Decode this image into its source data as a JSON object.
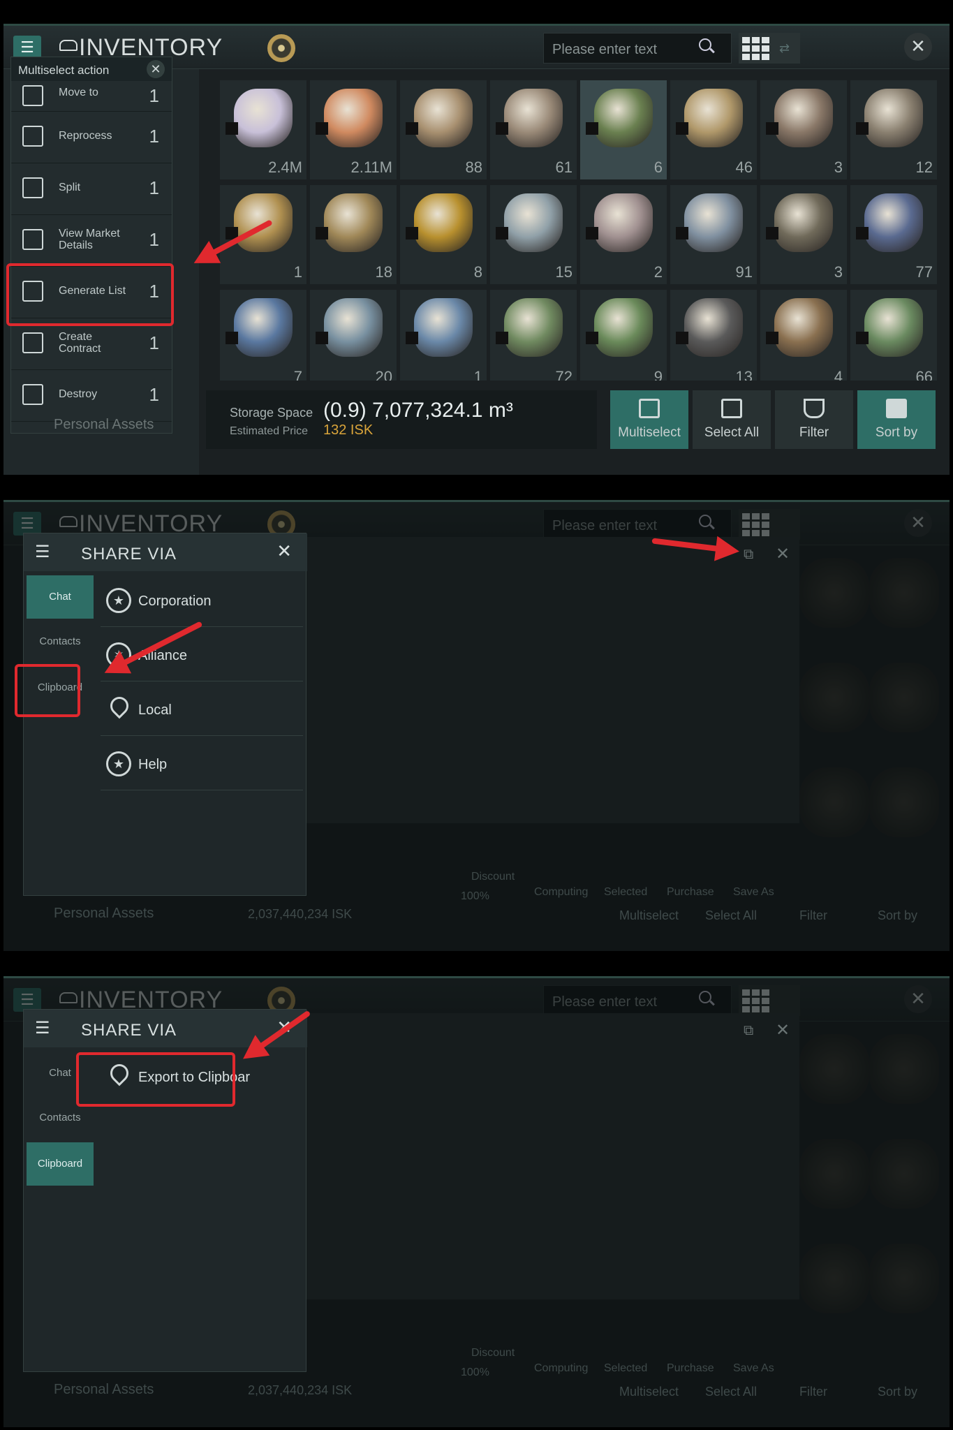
{
  "inventory": {
    "title": "INVENTORY",
    "search_placeholder": "Please enter text",
    "items": [
      {
        "count": "2.4M",
        "color": "#c8c0d8"
      },
      {
        "count": "2.11M",
        "color": "#d08a60"
      },
      {
        "count": "88",
        "color": "#a89070"
      },
      {
        "count": "61",
        "color": "#9a8a78"
      },
      {
        "count": "6",
        "color": "#6a8050",
        "selected": true
      },
      {
        "count": "46",
        "color": "#b0986a"
      },
      {
        "count": "3",
        "color": "#8a7868"
      },
      {
        "count": "12",
        "color": "#8a8070"
      },
      {
        "count": "1",
        "color": "#b09050"
      },
      {
        "count": "18",
        "color": "#a08858"
      },
      {
        "count": "8",
        "color": "#b8902e"
      },
      {
        "count": "15",
        "color": "#90a0a8"
      },
      {
        "count": "2",
        "color": "#a09090"
      },
      {
        "count": "91",
        "color": "#8090a0"
      },
      {
        "count": "3",
        "color": "#706a5a"
      },
      {
        "count": "77",
        "color": "#5a6a90"
      },
      {
        "count": "7",
        "color": "#5a78a0"
      },
      {
        "count": "20",
        "color": "#7890a0"
      },
      {
        "count": "1",
        "color": "#6a88a8"
      },
      {
        "count": "72",
        "color": "#708a60"
      },
      {
        "count": "9",
        "color": "#6a8a5a"
      },
      {
        "count": "13",
        "color": "#5a5a5a"
      },
      {
        "count": "4",
        "color": "#8a7050"
      },
      {
        "count": "66",
        "color": "#6a8a60"
      }
    ],
    "storage_label": "Storage Space",
    "storage_value": "(0.9) 7,077,324.1 m³",
    "price_label": "Estimated Price",
    "price_value": "132 ISK",
    "bottom_buttons": [
      "Multiselect",
      "Select All",
      "Filter",
      "Sort by"
    ],
    "left_footer": "Personal Assets"
  },
  "multiselect": {
    "title": "Multiselect action",
    "actions": [
      {
        "label": "Move to",
        "count": "1"
      },
      {
        "label": "Reprocess",
        "count": "1"
      },
      {
        "label": "Split",
        "count": "1"
      },
      {
        "label": "View Market Details",
        "count": "1"
      },
      {
        "label": "Generate List",
        "count": "1"
      },
      {
        "label": "Create Contract",
        "count": "1"
      },
      {
        "label": "Destroy",
        "count": "1"
      }
    ]
  },
  "share": {
    "title": "SHARE VIA",
    "tabs": [
      "Chat",
      "Contacts",
      "Clipboard"
    ],
    "chat_options": [
      "Corporation",
      "Alliance",
      "Local",
      "Help"
    ],
    "clipboard_options": [
      "Export to Clipboar"
    ]
  },
  "background_ui": {
    "discount_label": "Discount",
    "discount_value": "100%",
    "columns": [
      "Computing",
      "Selected",
      "Purchase",
      "Save As"
    ],
    "estimated_price": "2,037,440,234 ISK"
  }
}
